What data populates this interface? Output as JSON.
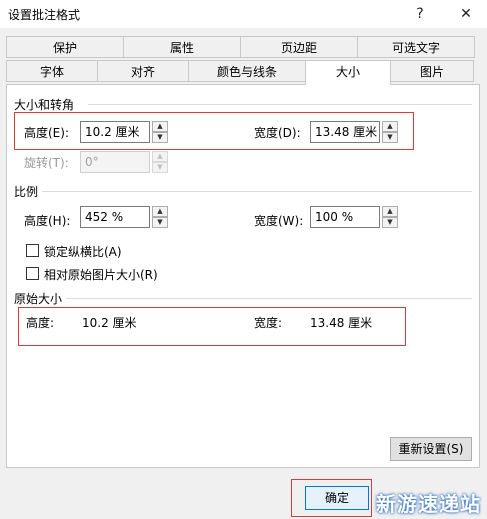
{
  "window": {
    "title": "设置批注格式",
    "help": "?",
    "close": "✕"
  },
  "tabs_row1": [
    "保护",
    "属性",
    "页边距",
    "可选文字"
  ],
  "tabs_row2": [
    "字体",
    "对齐",
    "颜色与线条",
    "大小",
    "图片"
  ],
  "size_rotate": {
    "heading": "大小和转角",
    "height_label": "高度(E):",
    "height_value": "10.2 厘米",
    "width_label": "宽度(D):",
    "width_value": "13.48 厘米",
    "rotate_label": "旋转(T):",
    "rotate_value": "0°"
  },
  "scale": {
    "heading": "比例",
    "height_label": "高度(H):",
    "height_value": "452 %",
    "width_label": "宽度(W):",
    "width_value": "100 %",
    "lock_aspect_label": "锁定纵横比(A)",
    "relative_label": "相对原始图片大小(R)"
  },
  "original": {
    "heading": "原始大小",
    "height_label": "高度:",
    "height_value": "10.2 厘米",
    "width_label": "宽度:",
    "width_value": "13.48 厘米"
  },
  "buttons": {
    "reset": "重新设置(S)",
    "ok": "确定"
  },
  "watermark": "新游速递站",
  "colors": {
    "highlight": "#d93b3b",
    "accent": "#0078d7"
  }
}
